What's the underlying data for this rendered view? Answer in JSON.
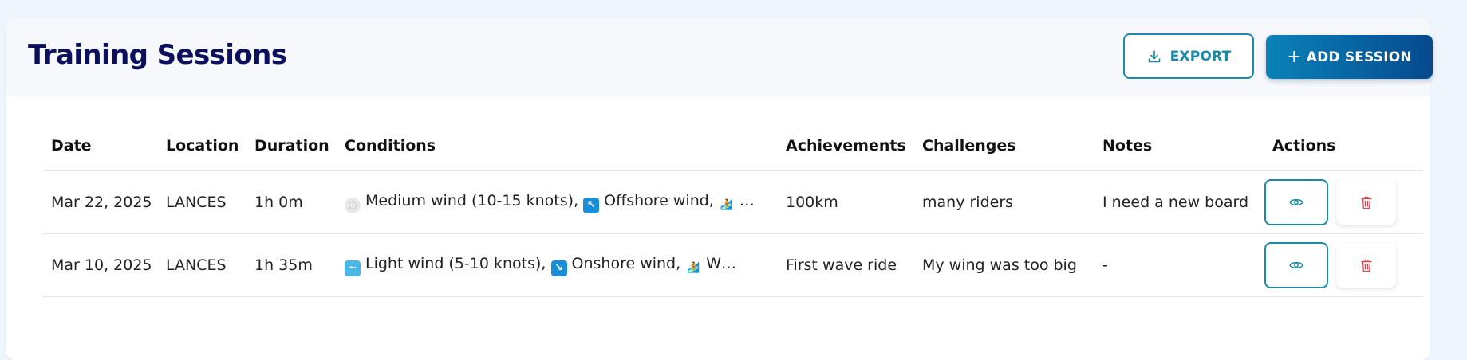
{
  "header": {
    "title": "Training Sessions",
    "export_label": "EXPORT",
    "add_label": "ADD SESSION"
  },
  "table": {
    "columns": [
      "Date",
      "Location",
      "Duration",
      "Conditions",
      "Achievements",
      "Challenges",
      "Notes",
      "Actions"
    ],
    "rows": [
      {
        "date": "Mar 22, 2025",
        "location": "LANCES",
        "duration": "1h 0m",
        "conditions": [
          {
            "icon": "medium-wind-icon",
            "glyph": "◌",
            "text": "Medium wind (10-15 knots),"
          },
          {
            "icon": "offshore-arrow-icon",
            "glyph": "↖",
            "text": "Offshore wind,"
          },
          {
            "icon": "surfer-icon",
            "glyph": "🏄",
            "text": "…"
          }
        ],
        "achievements": "100km",
        "challenges": "many riders",
        "notes": "I need a new board"
      },
      {
        "date": "Mar 10, 2025",
        "location": "LANCES",
        "duration": "1h 35m",
        "conditions": [
          {
            "icon": "light-wind-icon",
            "glyph": "~",
            "text": "Light wind (5-10 knots),"
          },
          {
            "icon": "onshore-arrow-icon",
            "glyph": "↘",
            "text": "Onshore wind,"
          },
          {
            "icon": "surfer-icon",
            "glyph": "🏄",
            "text": "W…"
          }
        ],
        "achievements": "First wave ride",
        "challenges": "My wing was too big",
        "notes": "-"
      }
    ]
  },
  "colors": {
    "title": "#0c0f5c",
    "accent": "#1a8aa6",
    "primary_gradient_start": "#0a82b8",
    "primary_gradient_end": "#064a8e",
    "delete": "#e0434f"
  }
}
